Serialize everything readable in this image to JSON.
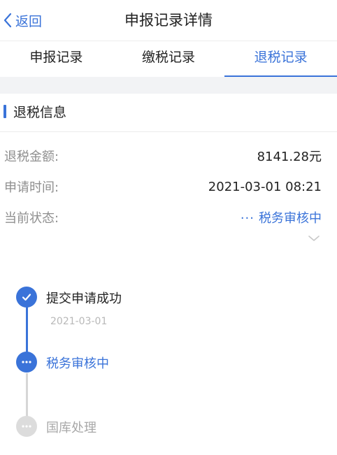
{
  "nav": {
    "back_label": "返回",
    "title": "申报记录详情"
  },
  "tabs": [
    {
      "label": "申报记录",
      "active": false
    },
    {
      "label": "缴税记录",
      "active": false
    },
    {
      "label": "退税记录",
      "active": true
    }
  ],
  "section": {
    "title": "退税信息"
  },
  "info": {
    "amount_label": "退税金额:",
    "amount_value": "8141.28元",
    "time_label": "申请时间:",
    "time_value": "2021-03-01 08:21",
    "status_label": "当前状态:",
    "status_dots": "···",
    "status_value": "税务审核中"
  },
  "timeline": [
    {
      "label": "提交申请成功",
      "date": "2021-03-01",
      "state": "done",
      "icon": "check-icon"
    },
    {
      "label": "税务审核中",
      "date": "",
      "state": "current",
      "icon": "ellipsis-icon"
    },
    {
      "label": "国库处理",
      "date": "",
      "state": "pending",
      "icon": "ellipsis-icon"
    }
  ],
  "colors": {
    "accent": "#3a73d9",
    "muted": "#8f8f8f",
    "pending": "#d6d6d6",
    "background_gap": "#f2f3f5"
  },
  "icons": {
    "back": "chevron-left-icon",
    "expand": "chevron-down-icon"
  }
}
